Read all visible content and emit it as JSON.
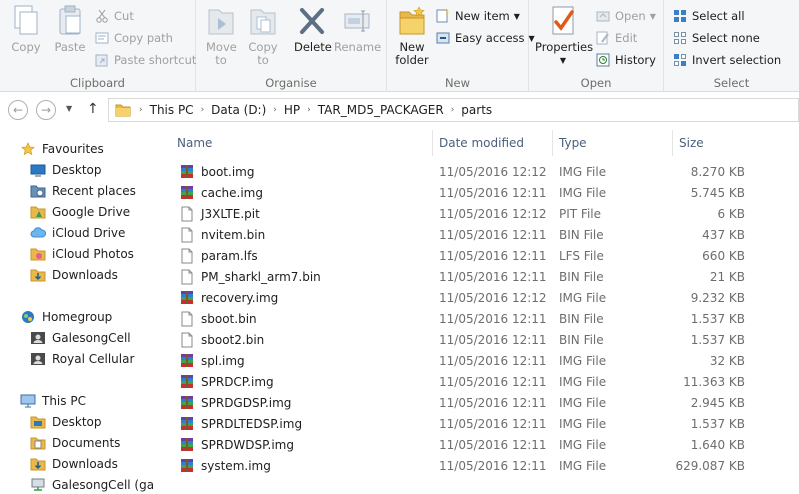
{
  "ribbon": {
    "clipboard": {
      "label": "Clipboard",
      "copy": "Copy",
      "paste": "Paste",
      "cut": "Cut",
      "copy_path": "Copy path",
      "paste_shortcut": "Paste shortcut"
    },
    "organise": {
      "label": "Organise",
      "move_to": "Move to",
      "copy_to": "Copy to",
      "delete": "Delete",
      "rename": "Rename"
    },
    "new": {
      "label": "New",
      "new_folder": "New folder",
      "new_item": "New item",
      "easy_access": "Easy access"
    },
    "open": {
      "label": "Open",
      "properties": "Properties",
      "open": "Open",
      "edit": "Edit",
      "history": "History"
    },
    "select": {
      "label": "Select",
      "select_all": "Select all",
      "select_none": "Select none",
      "invert_selection": "Invert selection"
    }
  },
  "address": {
    "crumbs": [
      "This PC",
      "Data (D:)",
      "HP",
      "TAR_MD5_PACKAGER",
      "parts"
    ]
  },
  "nav": {
    "favourites": "Favourites",
    "favourite_items": [
      "Desktop",
      "Recent places",
      "Google Drive",
      "iCloud Drive",
      "iCloud Photos",
      "Downloads"
    ],
    "homegroup": "Homegroup",
    "homegroup_items": [
      "GalesongCell",
      "Royal Cellular"
    ],
    "this_pc": "This PC",
    "pc_items": [
      "Desktop",
      "Documents",
      "Downloads",
      "GalesongCell (ga"
    ]
  },
  "columns": {
    "name": "Name",
    "date": "Date modified",
    "type": "Type",
    "size": "Size"
  },
  "files": [
    {
      "name": "boot.img",
      "date": "11/05/2016 12:12",
      "type": "IMG File",
      "size": "8.270 KB",
      "icon": "archive-icon"
    },
    {
      "name": "cache.img",
      "date": "11/05/2016 12:11",
      "type": "IMG File",
      "size": "5.745 KB",
      "icon": "archive-icon"
    },
    {
      "name": "J3XLTE.pit",
      "date": "11/05/2016 12:12",
      "type": "PIT File",
      "size": "6 KB",
      "icon": "document-icon"
    },
    {
      "name": "nvitem.bin",
      "date": "11/05/2016 12:11",
      "type": "BIN File",
      "size": "437 KB",
      "icon": "document-icon"
    },
    {
      "name": "param.lfs",
      "date": "11/05/2016 12:11",
      "type": "LFS File",
      "size": "660 KB",
      "icon": "document-icon"
    },
    {
      "name": "PM_sharkl_arm7.bin",
      "date": "11/05/2016 12:11",
      "type": "BIN File",
      "size": "21 KB",
      "icon": "document-icon"
    },
    {
      "name": "recovery.img",
      "date": "11/05/2016 12:12",
      "type": "IMG File",
      "size": "9.232 KB",
      "icon": "archive-icon"
    },
    {
      "name": "sboot.bin",
      "date": "11/05/2016 12:11",
      "type": "BIN File",
      "size": "1.537 KB",
      "icon": "document-icon"
    },
    {
      "name": "sboot2.bin",
      "date": "11/05/2016 12:11",
      "type": "BIN File",
      "size": "1.537 KB",
      "icon": "document-icon"
    },
    {
      "name": "spl.img",
      "date": "11/05/2016 12:11",
      "type": "IMG File",
      "size": "32 KB",
      "icon": "archive-icon"
    },
    {
      "name": "SPRDCP.img",
      "date": "11/05/2016 12:11",
      "type": "IMG File",
      "size": "11.363 KB",
      "icon": "archive-icon"
    },
    {
      "name": "SPRDGDSP.img",
      "date": "11/05/2016 12:11",
      "type": "IMG File",
      "size": "2.945 KB",
      "icon": "archive-icon"
    },
    {
      "name": "SPRDLTEDSP.img",
      "date": "11/05/2016 12:11",
      "type": "IMG File",
      "size": "1.537 KB",
      "icon": "archive-icon"
    },
    {
      "name": "SPRDWDSP.img",
      "date": "11/05/2016 12:11",
      "type": "IMG File",
      "size": "1.640 KB",
      "icon": "archive-icon"
    },
    {
      "name": "system.img",
      "date": "11/05/2016 12:11",
      "type": "IMG File",
      "size": "629.087 KB",
      "icon": "archive-icon"
    }
  ]
}
